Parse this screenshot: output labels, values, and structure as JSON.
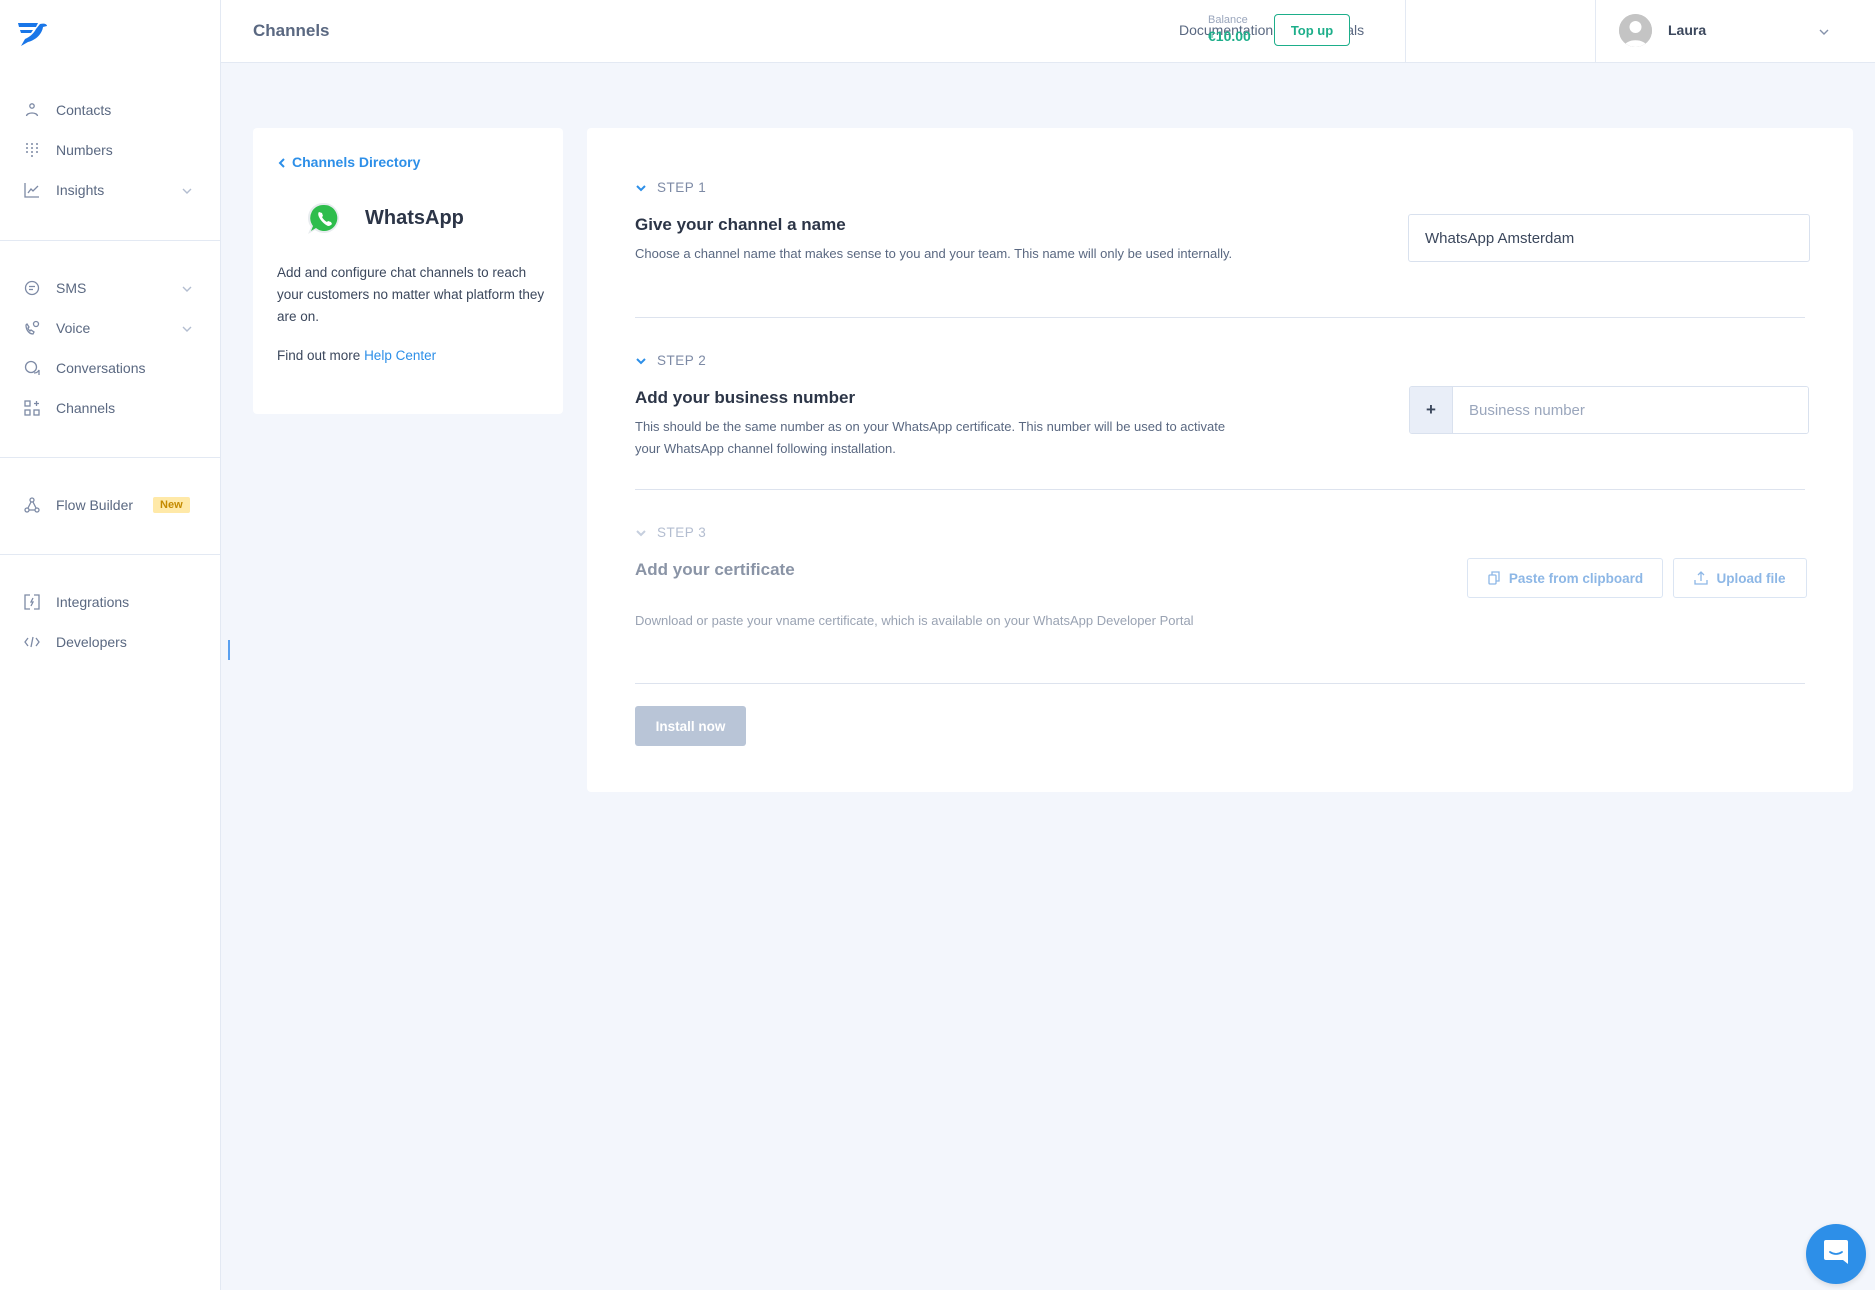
{
  "sidebar": {
    "logo": "messagebird-logo-icon",
    "groups": [
      {
        "items": [
          {
            "label": "Contacts",
            "icon": "person-icon",
            "expandable": false
          },
          {
            "label": "Numbers",
            "icon": "dialpad-icon",
            "expandable": false
          },
          {
            "label": "Insights",
            "icon": "chart-icon",
            "expandable": true
          }
        ]
      },
      {
        "items": [
          {
            "label": "SMS",
            "icon": "sms-bubble-icon",
            "expandable": true
          },
          {
            "label": "Voice",
            "icon": "phone-icon",
            "expandable": true
          },
          {
            "label": "Conversations",
            "icon": "conversations-icon",
            "expandable": false
          },
          {
            "label": "Channels",
            "icon": "channels-grid-icon",
            "expandable": false
          }
        ]
      },
      {
        "items": [
          {
            "label": "Flow Builder",
            "icon": "flow-icon",
            "badge": "New"
          }
        ]
      },
      {
        "items": [
          {
            "label": "Integrations",
            "icon": "integrations-icon"
          },
          {
            "label": "Developers",
            "icon": "code-icon"
          }
        ]
      }
    ]
  },
  "header": {
    "title": "Channels",
    "links": [
      "Documentation",
      "Tutorials"
    ],
    "balance_label": "Balance",
    "balance_value": "€10.00",
    "topup_label": "Top up",
    "user_name": "Laura"
  },
  "info_card": {
    "back_label": "Channels Directory",
    "channel_name": "WhatsApp",
    "description": "Add and configure chat channels to reach your customers no matter what platform they are on.",
    "more_prefix": "Find out more",
    "more_link": "Help Center"
  },
  "steps": [
    {
      "label": "STEP 1",
      "title": "Give your channel a name",
      "description": "Choose a channel name that makes sense to you and your team. This name will only be used internally.",
      "input_value": "WhatsApp Amsterdam",
      "enabled": true
    },
    {
      "label": "STEP 2",
      "title": "Add your business number",
      "description": "This should be the same number as on your WhatsApp certificate. This number will be used to activate your WhatsApp channel following installation.",
      "prefix": "+",
      "input_placeholder": "Business number",
      "input_value": "",
      "enabled": true
    },
    {
      "label": "STEP 3",
      "title": "Add your certificate",
      "description": "Download or paste your vname certificate, which is available on your WhatsApp Developer Portal",
      "paste_label": "Paste from clipboard",
      "upload_label": "Upload file",
      "enabled": false
    }
  ],
  "install_label": "Install now",
  "colors": {
    "accent": "#2d8fe8",
    "success": "#1dae8a",
    "badge_bg": "#ffe9a8",
    "badge_text": "#c48a00",
    "disabled_button": "#b9c5d7",
    "page_bg": "#f3f6fc"
  }
}
